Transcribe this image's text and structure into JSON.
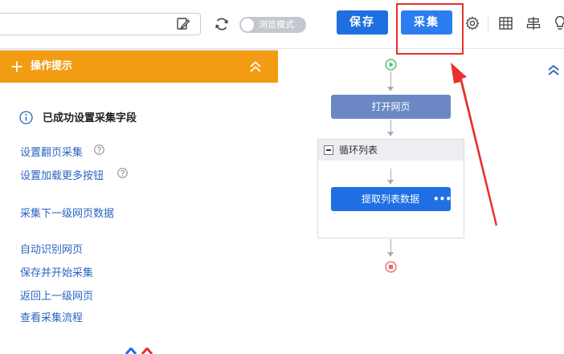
{
  "toolbar": {
    "url_value": "",
    "browse_mode_label": "浏览模式",
    "save_label": "保存",
    "collect_label": "采集"
  },
  "tips": {
    "title": "操作提示",
    "success_text": "已成功设置采集字段",
    "links": [
      "设置翻页采集",
      "设置加载更多按钮",
      "采集下一级网页数据",
      "自动识别网页",
      "保存并开始采集",
      "返回上一级网页",
      "查看采集流程"
    ]
  },
  "flow": {
    "open_page_label": "打开网页",
    "loop_label": "循环列表",
    "extract_label": "提取列表数据",
    "more_label": "•••"
  },
  "colors": {
    "accent_blue": "#1e6fe0",
    "tips_orange": "#f29c13",
    "annotation_red": "#e8312c"
  }
}
